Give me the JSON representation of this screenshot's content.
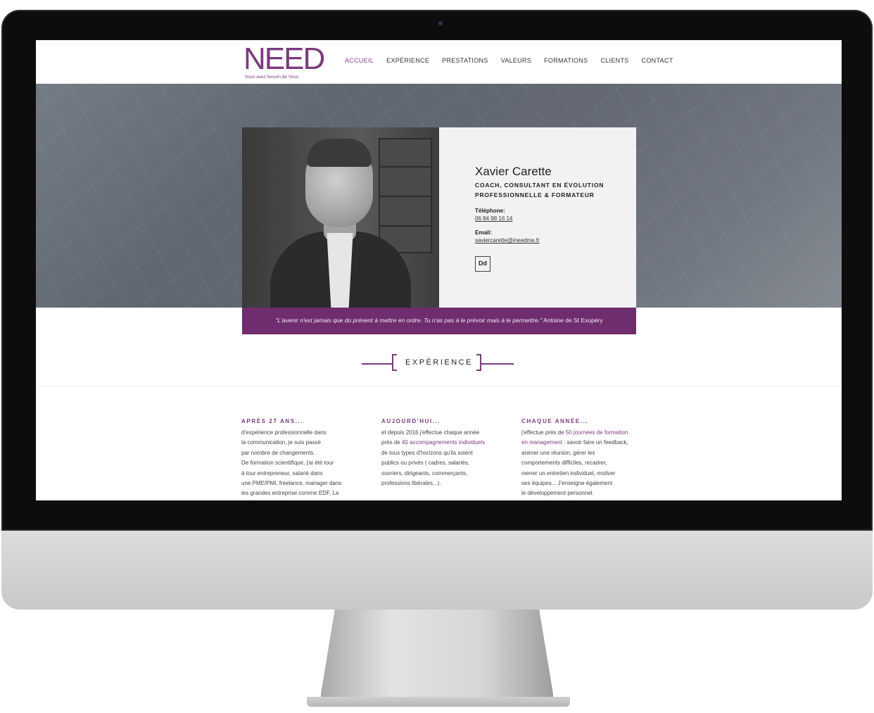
{
  "logo": {
    "mark": "NEED",
    "tagline": "Vous avez besoin de Vous"
  },
  "nav": [
    {
      "label": "ACCUEIL"
    },
    {
      "label": "EXPÉRIENCE"
    },
    {
      "label": "PRESTATIONS"
    },
    {
      "label": "VALEURS"
    },
    {
      "label": "FORMATIONS"
    },
    {
      "label": "CLIENTS"
    },
    {
      "label": "CONTACT"
    }
  ],
  "card": {
    "name": "Xavier Carette",
    "role": "COACH, CONSULTANT EN ÉVOLUTION PROFESSIONNELLE & FORMATEUR",
    "phone_label": "Téléphone:",
    "phone": "06 84 98 16 14",
    "email_label": "Email:",
    "email": "xaviercarette@ineedme.fr",
    "vcard_icon_text": "Dd"
  },
  "quote": {
    "text": "\"L'avenir n'est jamais que du présent à mettre en ordre. Tu n'as pas à le prévoir mais à le permettre.\"",
    "author": "Antoine de St Exupéry"
  },
  "section": {
    "title": "EXPÉRIENCE"
  },
  "columns": [
    {
      "title": "APRÈS 27 ANS...",
      "lines": [
        "d'expérience professionnelle dans",
        "la communication, je suis passé",
        "par nombre de changements.",
        "De formation scientifique, j'ai été tour",
        "à tour entrepreneur, salarié dans",
        "une PME/PMI, freelance, manager dans",
        "les grandes entreprise comme EDF, La"
      ]
    },
    {
      "title": "AUJOURD'HUI...",
      "line1": "et depuis 2016 j'effectue chaque année",
      "line2_pre": "près de ",
      "line2_hl": "40 accompagnements individuels",
      "line3": "de tous types d'horizons qu'ils soient",
      "line4": "publics ou privés ( cadres, salariés,",
      "line5": "ouvriers, dirigeants, commerçants,",
      "line6": "professions libérales...)."
    },
    {
      "title": "CHAQUE ANNÉE...",
      "line1_pre": "j'effectue près de ",
      "line1_hl": "50 journées de formation",
      "line2_hl": "en management",
      "line2_post": " : savoir faire un feedback,",
      "line3": "animer une réunion, gérer les",
      "line4": "comportements difficiles, recadrer,",
      "line5": "mener un entretien individuel, motiver",
      "line6": "ses équipes... J'enseigne également",
      "line7": "le développement personnel."
    }
  ],
  "colors": {
    "accent": "#7b3a7e",
    "quote_bg": "#6f2d6f",
    "card_bg": "#f2f2f2"
  }
}
